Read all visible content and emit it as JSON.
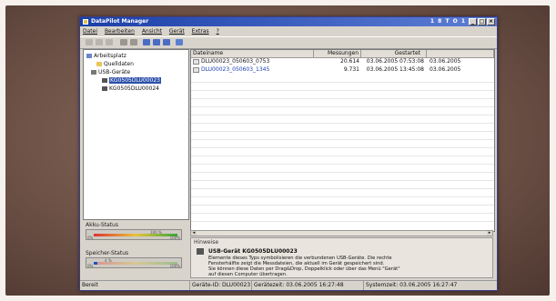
{
  "window": {
    "title": "DataPilot Manager",
    "tray": "1 8 T O 1"
  },
  "menu": [
    "Datei",
    "Bearbeiten",
    "Ansicht",
    "Gerät",
    "Extras",
    "?"
  ],
  "tree": {
    "root": "Arbeitsplatz",
    "quelldaten": "Quelldaten",
    "usb": "USB-Geräte",
    "devices": [
      "KG0505DLU00023",
      "KG0505DLU00024"
    ]
  },
  "panels": {
    "akku_label": "Akku-Status",
    "akku_value": "100 %",
    "akku_percent": 100,
    "akku_scale_left": "0%",
    "akku_scale_right": "100%",
    "speicher_label": "Speicher-Status",
    "speicher_value": "4 %",
    "speicher_percent": 4,
    "speicher_scale_left": "0%",
    "speicher_scale_right": "100%"
  },
  "list": {
    "headers": [
      "Dateiname",
      "Messungen",
      "Gestartet",
      ""
    ],
    "rows": [
      {
        "name": "DLU00023_050603_0753",
        "count": "20.614",
        "started": "03.06.2005 07:53:08",
        "ended": "03.06.2005"
      },
      {
        "name": "DLU00023_050603_1345",
        "count": "9.731",
        "started": "03.06.2005 13:45:08",
        "ended": "03.06.2005"
      }
    ]
  },
  "hints": {
    "label": "Hinweise",
    "title": "USB-Gerät KG0505DLU00023",
    "line1": "Elemente dieses Typs symbolisieren die verbundenen USB-Geräte. Die rechte",
    "line2": "Fensterhälfte zeigt die Messdateien, die aktuell im Gerät gespeichert sind.",
    "line3": "Sie können diese Daten per Drag&Drop, Doppelklick oder über das Menü \"Gerät\"",
    "line4": "auf diesen Computer übertragen."
  },
  "status": {
    "ready": "Bereit",
    "device_id": "Geräte-ID: DLU00023",
    "device_time": "Gerätezeit: 03.06.2005 16:27:48",
    "system_time": "Systemzeit: 03.06.2005 16:27:47"
  },
  "colors": {
    "titlebar": "#1b3fa8",
    "selection": "#2a4fa8",
    "link": "#1a3fb0"
  }
}
